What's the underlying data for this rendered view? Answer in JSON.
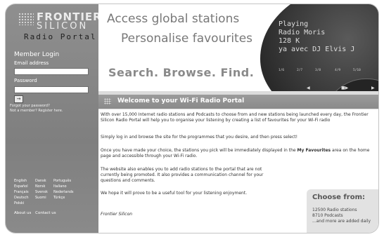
{
  "brand": {
    "line1": "FRONTIER",
    "line2": "SILICON",
    "line3": "Radio Portal"
  },
  "login": {
    "title": "Member Login",
    "email_label": "Email address",
    "password_label": "Password",
    "go_label": "→",
    "forgot": "Forgot your password?",
    "not_member": "Not a member?",
    "register": "Register here."
  },
  "languages": [
    [
      "English",
      "Dansk",
      "Português"
    ],
    [
      "Español",
      "Norsk",
      "Italiano"
    ],
    [
      "Français",
      "Svensk",
      "Nederlands"
    ],
    [
      "Deutsch",
      "Suomi",
      "Türkçe"
    ],
    [
      "Polski",
      "",
      ""
    ]
  ],
  "footer_links": [
    "About us",
    "Contact us"
  ],
  "header": {
    "tagline1": "Access global stations",
    "tagline2": "Personalise favourites",
    "tagline3": "Search. Browse. Find.",
    "display_lines": [
      "Playing",
      "Radio Moris",
      "128 K",
      "ya avec DJ Elvis J"
    ],
    "presets": [
      "1/6",
      "2/7",
      "3/8",
      "4/9",
      "5/10"
    ]
  },
  "welcome": {
    "title": "Welcome to your Wi-Fi Radio Portal",
    "p1": "With over 15,000 Internet radio stations and Podcasts to choose from and new stations being launched every day, the Frontier Silicon Radio Portal will help you to organise your listening by creating a list of favourites for your Wi-Fi radio",
    "p2": "Simply log in and browse the site for the programmes that you desire, and then press select!",
    "p3_before": "Once you have made your choice, the stations you pick will be immediately displayed in the ",
    "p3_bold": "My Favourites",
    "p3_after": " area on the home page and accessible through your Wi-Fi radio.",
    "p4": "The website also enables you to add radio stations to the portal that are not currently being promoted. It also provides a communication channel for your questions and comments.",
    "p5": "We hope it will prove to be a useful tool for your listening enjoyment.",
    "signature": "Frontier Silicon"
  },
  "choose": {
    "title": "Choose from:",
    "lines": [
      "12500 Radio stations",
      "8710 Podcasts",
      "...and more are added daily"
    ]
  }
}
